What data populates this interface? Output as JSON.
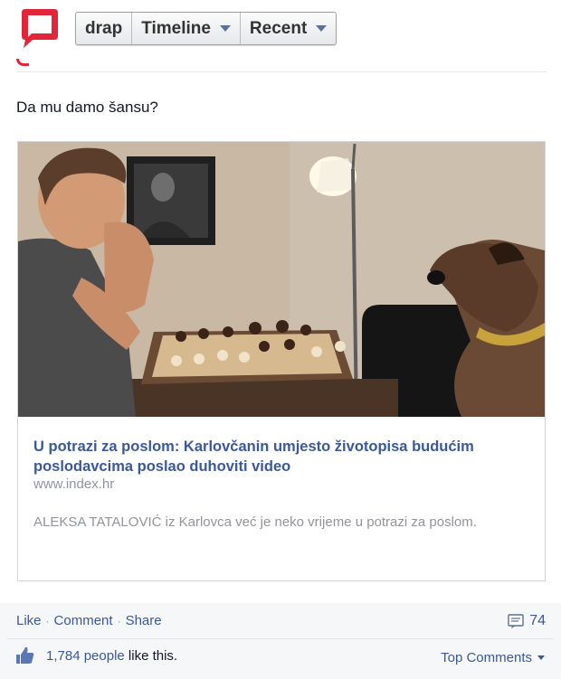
{
  "header": {
    "menu": [
      {
        "label": "drap",
        "has_caret": false
      },
      {
        "label": "Timeline",
        "has_caret": true
      },
      {
        "label": "Recent",
        "has_caret": true
      }
    ]
  },
  "post": {
    "text": "Da mu damo šansu?",
    "link": {
      "title": "U potrazi za poslom: Karlovčanin umjesto životopisa budućim poslodavcima poslao duhoviti video",
      "domain": "www.index.hr",
      "description": "ALEKSA TATALOVIĆ iz Karlovca već je neko vrijeme u potrazi za poslom."
    }
  },
  "actions": {
    "like": "Like",
    "comment": "Comment",
    "share": "Share",
    "comment_count": "74"
  },
  "likes": {
    "count": "1,784 people",
    "suffix": " like this."
  },
  "sort": {
    "label": "Top Comments"
  },
  "colors": {
    "link": "#3b5998",
    "muted": "#90949c",
    "logo_red": "#e2263a"
  }
}
